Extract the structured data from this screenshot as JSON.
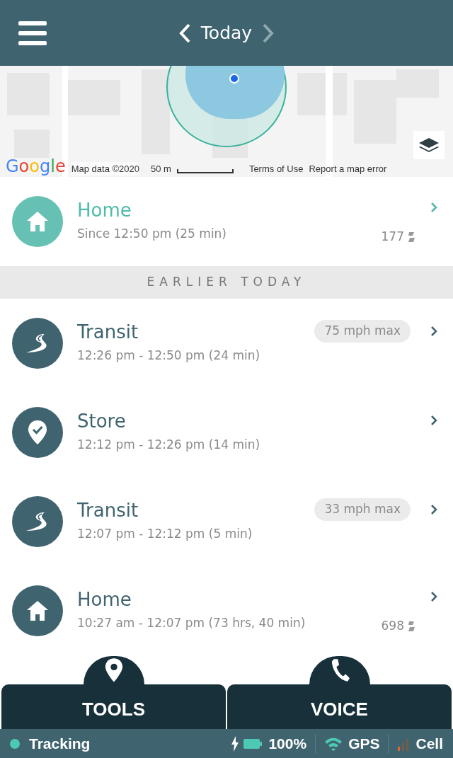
{
  "header": {
    "title": "Today",
    "prev_disabled": false,
    "next_disabled": true
  },
  "map": {
    "logo": "Google",
    "attribution": "Map data ©2020",
    "scale": "50 m",
    "terms": "Terms of Use",
    "report": "Report a map error"
  },
  "current": {
    "kind": "home",
    "title": "Home",
    "time": "Since 12:50 pm (25 min)",
    "count": "177"
  },
  "section_title": "EARLIER TODAY",
  "places": [
    {
      "kind": "transit",
      "title": "Transit",
      "time": "12:26 pm - 12:50 pm (24 min)",
      "badge": "75 mph max"
    },
    {
      "kind": "store",
      "title": "Store",
      "time": "12:12 pm - 12:26 pm (14 min)"
    },
    {
      "kind": "transit",
      "title": "Transit",
      "time": "12:07 pm - 12:12 pm (5 min)",
      "badge": "33 mph max"
    },
    {
      "kind": "home",
      "title": "Home",
      "time": "10:27 am - 12:07 pm (73 hrs, 40 min)",
      "count": "698"
    }
  ],
  "bottom_tabs": [
    {
      "kind": "pin",
      "label": "TOOLS"
    },
    {
      "kind": "phone",
      "label": "VOICE"
    }
  ],
  "status": {
    "tracking": "Tracking",
    "battery": "100%",
    "gps": "GPS",
    "cell": "Cell"
  }
}
